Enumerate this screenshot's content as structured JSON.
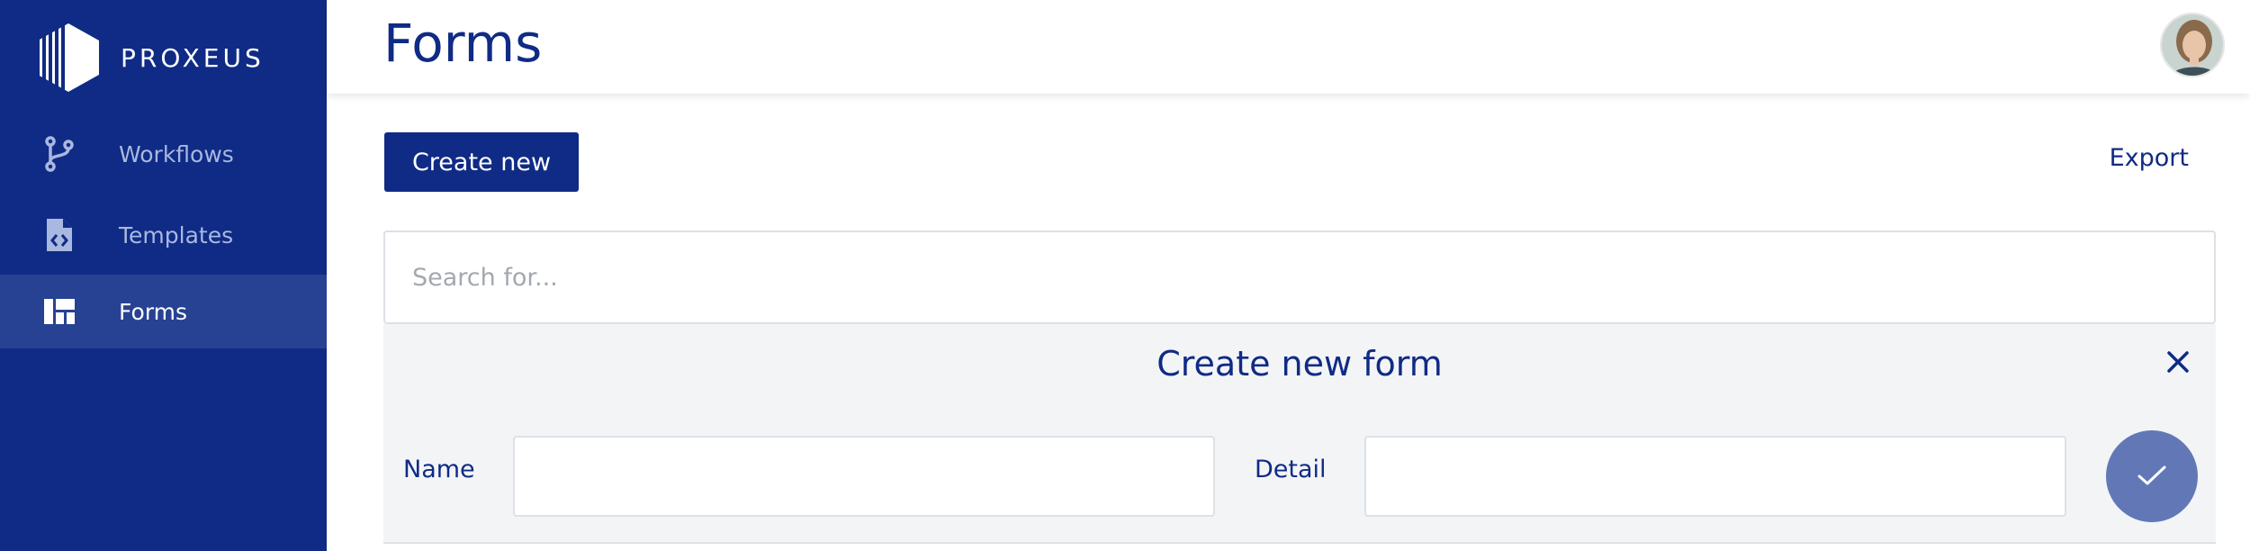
{
  "app": {
    "name": "PROXEUS"
  },
  "sidebar": {
    "items": [
      {
        "label": "Workflows",
        "icon": "workflow-branch-icon",
        "active": false
      },
      {
        "label": "Templates",
        "icon": "template-file-code-icon",
        "active": false
      },
      {
        "label": "Forms",
        "icon": "forms-grid-icon",
        "active": true
      }
    ]
  },
  "header": {
    "title": "Forms"
  },
  "toolbar": {
    "create_label": "Create new",
    "export_label": "Export"
  },
  "search": {
    "placeholder": "Search for..."
  },
  "create_form": {
    "title": "Create new form",
    "name_label": "Name",
    "detail_label": "Detail"
  },
  "colors": {
    "sidebar_bg": "#0f2b85",
    "sidebar_active_bg": "#274293",
    "accent": "#0f2b85",
    "panel_bg": "#f3f4f6",
    "submit_bg": "#6278b6"
  }
}
